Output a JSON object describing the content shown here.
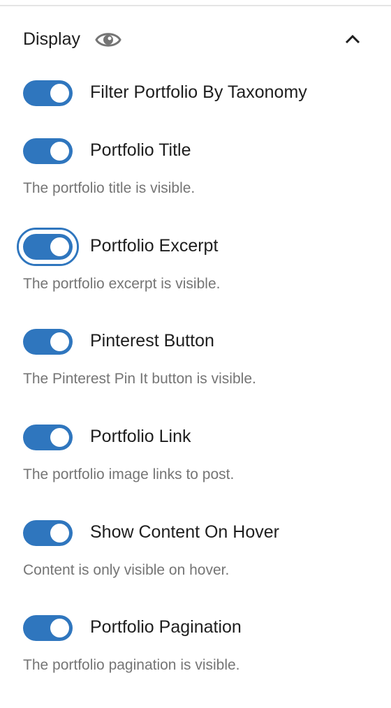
{
  "panel": {
    "title": "Display",
    "title_icon": "eye-icon",
    "collapse_icon": "chevron-up-icon",
    "accent_color": "#2f76be"
  },
  "options": [
    {
      "label": "Filter Portfolio By Taxonomy",
      "help": "",
      "checked": true,
      "focused": false
    },
    {
      "label": "Portfolio Title",
      "help": "The portfolio title is visible.",
      "checked": true,
      "focused": false
    },
    {
      "label": "Portfolio Excerpt",
      "help": "The portfolio excerpt is visible.",
      "checked": true,
      "focused": true
    },
    {
      "label": "Pinterest Button",
      "help": "The Pinterest Pin It button is visible.",
      "checked": true,
      "focused": false
    },
    {
      "label": "Portfolio Link",
      "help": "The portfolio image links to post.",
      "checked": true,
      "focused": false
    },
    {
      "label": "Show Content On Hover",
      "help": "Content is only visible on hover.",
      "checked": true,
      "focused": false
    },
    {
      "label": "Portfolio Pagination",
      "help": "The portfolio pagination is visible.",
      "checked": true,
      "focused": false
    }
  ]
}
